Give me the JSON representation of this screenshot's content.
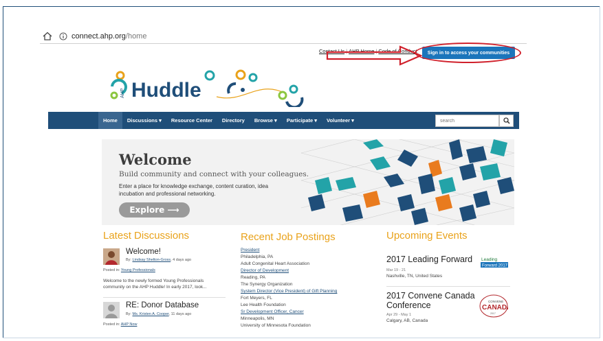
{
  "browser": {
    "url_host": "connect.ahp.org",
    "url_path": "/home"
  },
  "toplinks": [
    "Contact Us",
    "AHP Home",
    "Code of Conduct"
  ],
  "signin_label": "Sign in to access your communities",
  "logo": {
    "small_text": "AHP",
    "word": "Huddle"
  },
  "nav": {
    "items": [
      "Home",
      "Discussions ▾",
      "Resource Center",
      "Directory",
      "Browse ▾",
      "Participate ▾",
      "Volunteer ▾"
    ],
    "search_placeholder": "search"
  },
  "hero": {
    "title": "Welcome",
    "subtitle": "Build community and connect with your colleagues.",
    "desc": "Enter a place for knowledge exchange, content curation, idea incubation and professional networking.",
    "button": "Explore ⟶"
  },
  "discussions": {
    "heading": "Latest Discussions",
    "items": [
      {
        "title": "Welcome!",
        "by_prefix": "By: ",
        "author": "Lindsay Shelton-Gross",
        "age": ", 4 days ago",
        "posted_prefix": "Posted in: ",
        "community": "Young Professionals",
        "excerpt": "Welcome to the newly formed Young Professionals community on the AHP Huddle! In early 2017, look..."
      },
      {
        "title": "RE: Donor Database",
        "by_prefix": "By: ",
        "author": "Ms. Kristen A. Cooper",
        "age": ", 11 days ago",
        "posted_prefix": "Posted in: ",
        "community": "AHP Now",
        "excerpt": ""
      }
    ]
  },
  "jobs": {
    "heading": "Recent Job Postings",
    "items": [
      {
        "title": "President",
        "lines": [
          "Philadelphia, PA",
          "Adult Congenital Heart Association"
        ]
      },
      {
        "title": "Director of Development",
        "lines": [
          "Reading, PA",
          "The Synergy Organization"
        ]
      },
      {
        "title": "System Director (Vice President) of Gift Planning",
        "lines": [
          "Fort Meyers, FL",
          "Lee Health Foundation"
        ]
      },
      {
        "title": "Sr Development Officer, Cancer",
        "lines": [
          "Minneapolis, MN",
          "University of Minnesota Foundation"
        ]
      }
    ]
  },
  "events": {
    "heading": "Upcoming Events",
    "items": [
      {
        "title": "2017 Leading Forward",
        "date": "Mar 19 - 21",
        "location": "Nashville, TN, United States",
        "badge": "Leading Forward 2017"
      },
      {
        "title": "2017 Convene Canada Conference",
        "date": "Apr 29 - May 1",
        "location": "Calgary, AB, Canada",
        "badge": "CONVENE CANADA"
      }
    ]
  },
  "colors": {
    "nav_bg": "#1f4e79",
    "signin_bg": "#1b75bb",
    "heading_orange": "#e9a21a",
    "annotation_red": "#d0202b"
  }
}
